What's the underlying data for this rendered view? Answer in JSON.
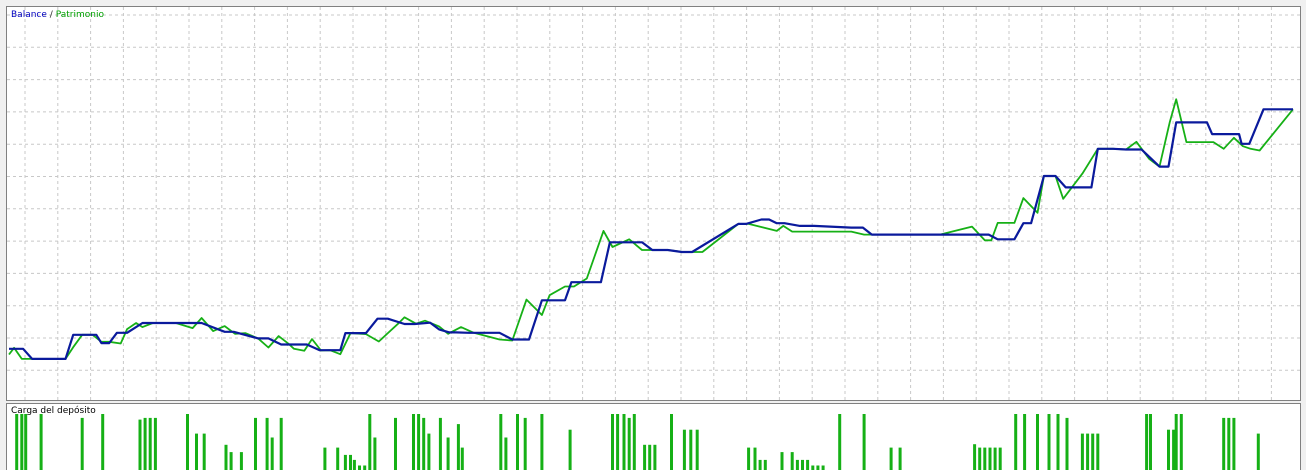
{
  "legend": {
    "balance_label": "Balance",
    "separator": "/",
    "equity_label": "Patrimonio"
  },
  "deposit_panel": {
    "title": "Carga del depósito"
  },
  "colors": {
    "balance": "#0a1a9c",
    "equity": "#16b016",
    "deposit_bars": "#16b016",
    "grid": "#c8c8c8"
  },
  "chart_data": [
    {
      "type": "line",
      "title": "",
      "legend": [
        "Balance",
        "Patrimonio"
      ],
      "grid": true,
      "xlim": [
        0,
        100
      ],
      "ylim": [
        0,
        100
      ],
      "series": [
        {
          "name": "Balance",
          "x": [
            0,
            1.1,
            1.8,
            4.4,
            5.0,
            6.8,
            7.2,
            7.8,
            8.4,
            9.2,
            10.4,
            10.8,
            12.0,
            13.0,
            15.0,
            16.8,
            17.5,
            19.4,
            20.2,
            21.2,
            23.2,
            24.2,
            25.8,
            26.2,
            27.8,
            28.7,
            29.5,
            30.8,
            31.6,
            32.8,
            33.5,
            34.3,
            34.8,
            35.8,
            38.2,
            39.2,
            40.5,
            41.5,
            43.3,
            43.8,
            46.1,
            46.8,
            49.3,
            50.1,
            51.3,
            52.4,
            53.2,
            56.8,
            57.4,
            58.6,
            59.2,
            59.8,
            60.4,
            61.6,
            62.7,
            65.6,
            66.5,
            67.2,
            69.0,
            70.7,
            72.5,
            76.3,
            77.0,
            78.3,
            79.0,
            79.6,
            80.6,
            81.5,
            82.3,
            84.3,
            84.8,
            86.0,
            87.0,
            88.2,
            89.6,
            90.3,
            90.9,
            93.3,
            93.7,
            95.8,
            96.0,
            96.6,
            97.7,
            100
          ],
          "y": [
            9.9,
            9.9,
            6.9,
            6.9,
            14.1,
            14.1,
            11.6,
            11.6,
            14.7,
            14.7,
            17.6,
            17.6,
            17.6,
            17.6,
            17.6,
            15.0,
            15.0,
            13.0,
            13.0,
            11.2,
            11.2,
            9.5,
            9.5,
            14.6,
            14.6,
            18.9,
            18.9,
            17.3,
            17.3,
            17.7,
            15.7,
            14.8,
            14.8,
            14.7,
            14.7,
            12.7,
            12.7,
            24.4,
            24.4,
            29.8,
            29.8,
            41.7,
            41.7,
            39.4,
            39.4,
            38.8,
            38.8,
            47.2,
            47.2,
            48.5,
            48.5,
            47.4,
            47.4,
            46.6,
            46.6,
            46.1,
            46.1,
            44.0,
            44.0,
            44.0,
            44.0,
            44.0,
            42.6,
            42.6,
            47.4,
            47.4,
            61.5,
            61.5,
            58.1,
            58.1,
            69.6,
            69.6,
            69.4,
            69.4,
            64.3,
            64.3,
            77.5,
            77.5,
            74.0,
            74.0,
            71.1,
            71.1,
            81.4,
            81.4
          ]
        },
        {
          "name": "Patrimonio",
          "x": [
            0,
            0.4,
            1.0,
            1.8,
            4.4,
            5.0,
            5.7,
            6.5,
            7.2,
            7.8,
            8.7,
            9.2,
            9.9,
            10.4,
            11.2,
            12.0,
            13.0,
            14.3,
            15.0,
            15.9,
            16.8,
            17.6,
            18.4,
            19.4,
            20.2,
            21.0,
            21.8,
            22.2,
            23.0,
            23.6,
            24.3,
            25.0,
            25.8,
            26.6,
            27.8,
            28.8,
            29.4,
            30.3,
            30.8,
            31.7,
            32.4,
            33.5,
            34.2,
            35.2,
            36.2,
            38.2,
            39.2,
            40.3,
            41.5,
            42.1,
            43.3,
            44.0,
            45.0,
            46.3,
            47.0,
            48.3,
            49.3,
            51.3,
            52.5,
            53.2,
            54.0,
            56.8,
            57.6,
            59.8,
            60.3,
            61.0,
            63.5,
            65.6,
            66.6,
            68.2,
            70.7,
            72.5,
            75.0,
            76.0,
            76.5,
            77.0,
            77.4,
            78.3,
            79.0,
            80.1,
            80.6,
            81.5,
            82.1,
            83.6,
            84.8,
            86.0,
            87.0,
            87.8,
            88.8,
            89.6,
            90.4,
            90.9,
            91.7,
            92.4,
            93.8,
            94.6,
            95.4,
            96.1,
            96.7,
            97.4,
            100
          ],
          "y": [
            8.2,
            10.2,
            6.9,
            6.9,
            6.9,
            10.4,
            14.1,
            14.1,
            12.0,
            12.0,
            11.5,
            15.8,
            17.6,
            16.4,
            17.6,
            17.6,
            17.6,
            16.1,
            19.1,
            15.2,
            16.7,
            14.4,
            14.6,
            13.0,
            10.3,
            13.7,
            11.3,
            9.9,
            9.3,
            12.8,
            9.4,
            9.5,
            8.3,
            14.6,
            14.3,
            12.1,
            14.2,
            17.4,
            19.3,
            17.4,
            18.3,
            16.6,
            14.4,
            16.4,
            14.7,
            12.7,
            12.4,
            24.6,
            20.0,
            25.9,
            28.5,
            28.5,
            30.9,
            45.1,
            40.3,
            42.6,
            39.4,
            39.4,
            38.8,
            38.8,
            38.8,
            47.2,
            47.2,
            45.1,
            46.6,
            44.9,
            44.9,
            44.9,
            44.0,
            44.0,
            44.0,
            44.0,
            46.4,
            42.3,
            42.3,
            47.5,
            47.5,
            47.5,
            54.9,
            50.5,
            61.5,
            61.5,
            54.7,
            62.2,
            69.6,
            69.6,
            69.4,
            71.7,
            66.6,
            64.3,
            77.5,
            84.4,
            71.6,
            71.6,
            71.6,
            69.6,
            72.9,
            70.4,
            69.6,
            69.1,
            81.4
          ]
        }
      ]
    },
    {
      "type": "bar",
      "title": "Carga del depósito",
      "grid": false,
      "xlim": [
        0,
        100
      ],
      "ylim": [
        0,
        100
      ],
      "x": [
        0.6,
        1.0,
        1.3,
        2.5,
        5.7,
        7.3,
        10.2,
        10.6,
        11.0,
        11.4,
        13.9,
        14.6,
        15.2,
        16.9,
        17.3,
        18.1,
        19.2,
        20.1,
        20.5,
        21.2,
        24.6,
        25.6,
        26.2,
        26.6,
        26.9,
        27.3,
        27.7,
        28.1,
        28.5,
        30.1,
        31.5,
        31.9,
        32.3,
        32.7,
        33.6,
        34.2,
        35.0,
        35.3,
        38.3,
        38.7,
        39.6,
        40.2,
        41.5,
        43.7,
        47.0,
        47.4,
        47.9,
        48.3,
        48.7,
        49.5,
        49.9,
        50.3,
        51.6,
        52.6,
        53.1,
        53.6,
        57.6,
        58.1,
        58.5,
        58.9,
        60.2,
        61.0,
        61.4,
        61.8,
        62.2,
        62.6,
        63.0,
        63.4,
        64.7,
        66.6,
        68.7,
        69.4,
        75.2,
        75.6,
        76.0,
        76.4,
        76.8,
        77.2,
        78.4,
        79.1,
        80.1,
        81.0,
        81.7,
        82.4,
        83.6,
        84.0,
        84.4,
        84.8,
        88.6,
        88.9,
        90.3,
        90.7,
        90.9,
        91.3,
        94.6,
        95.0,
        95.4,
        97.3
      ],
      "values": [
        100,
        100,
        100,
        100,
        93,
        100,
        90,
        93,
        93,
        93,
        100,
        65,
        65,
        45,
        32,
        32,
        93,
        93,
        58,
        93,
        40,
        40,
        27,
        27,
        18,
        8,
        8,
        100,
        58,
        93,
        100,
        100,
        93,
        65,
        93,
        58,
        82,
        40,
        100,
        58,
        100,
        93,
        100,
        72,
        100,
        100,
        100,
        93,
        100,
        45,
        45,
        45,
        100,
        72,
        72,
        72,
        40,
        40,
        18,
        18,
        32,
        32,
        18,
        18,
        18,
        8,
        8,
        8,
        100,
        100,
        40,
        40,
        46,
        40,
        40,
        40,
        40,
        40,
        100,
        100,
        100,
        100,
        100,
        93,
        65,
        65,
        65,
        65,
        100,
        100,
        72,
        72,
        100,
        100,
        93,
        93,
        93,
        65
      ]
    }
  ]
}
